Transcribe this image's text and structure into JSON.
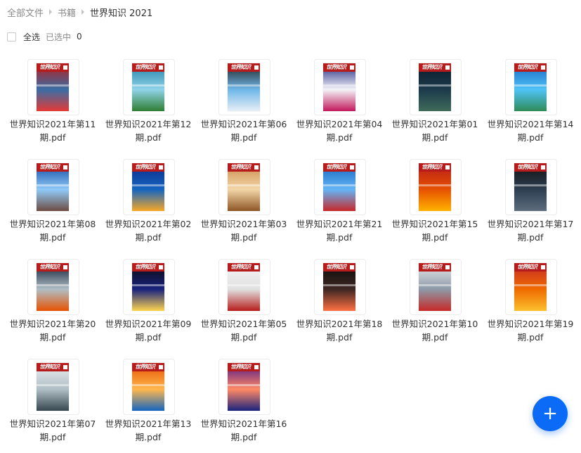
{
  "breadcrumb": [
    {
      "label": "全部文件"
    },
    {
      "label": "书籍"
    },
    {
      "label": "世界知识 2021"
    }
  ],
  "selection": {
    "select_all_label": "全选",
    "selected_label": "已选中",
    "selected_count": "0"
  },
  "masthead_text": "世界知识",
  "files": [
    {
      "name": "世界知识2021年第11期.pdf",
      "cover_colors": [
        "#b71c1c",
        "#3a6ea5",
        "#e53935"
      ]
    },
    {
      "name": "世界知识2021年第12期.pdf",
      "cover_colors": [
        "#1f7fa6",
        "#8fd3e8",
        "#2e7d32"
      ]
    },
    {
      "name": "世界知识2021年第06期.pdf",
      "cover_colors": [
        "#1e1e1e",
        "#6fb7e8",
        "#e8eef5"
      ]
    },
    {
      "name": "世界知识2021年第04期.pdf",
      "cover_colors": [
        "#1a237e",
        "#f3f3f8",
        "#c2185b"
      ]
    },
    {
      "name": "世界知识2021年第01期.pdf",
      "cover_colors": [
        "#0d1b2a",
        "#1b3a4b",
        "#3f6b5a"
      ]
    },
    {
      "name": "世界知识2021年第14期.pdf",
      "cover_colors": [
        "#1565c0",
        "#4fc3f7",
        "#2e8b57"
      ]
    },
    {
      "name": "世界知识2021年第08期.pdf",
      "cover_colors": [
        "#0d47a1",
        "#90caf9",
        "#6d4c41"
      ]
    },
    {
      "name": "世界知识2021年第02期.pdf",
      "cover_colors": [
        "#0d2a8a",
        "#1565c0",
        "#f9a825"
      ]
    },
    {
      "name": "世界知识2021年第03期.pdf",
      "cover_colors": [
        "#c98a4b",
        "#f3d6a7",
        "#8d5524"
      ]
    },
    {
      "name": "世界知识2021年第21期.pdf",
      "cover_colors": [
        "#1565c0",
        "#64b5f6",
        "#c62828"
      ]
    },
    {
      "name": "世界知识2021年第15期.pdf",
      "cover_colors": [
        "#b71c1c",
        "#e65100",
        "#ffb300"
      ]
    },
    {
      "name": "世界知识2021年第17期.pdf",
      "cover_colors": [
        "#111111",
        "#2c3e50",
        "#5d6d7e"
      ]
    },
    {
      "name": "世界知识2021年第20期.pdf",
      "cover_colors": [
        "#0b1a33",
        "#b0bec5",
        "#e65100"
      ]
    },
    {
      "name": "世界知识2021年第09期.pdf",
      "cover_colors": [
        "#0a0a0a",
        "#1a237e",
        "#ffd54f"
      ]
    },
    {
      "name": "世界知识2021年第05期.pdf",
      "cover_colors": [
        "#f5f5f5",
        "#e0e0e0",
        "#b71c1c"
      ]
    },
    {
      "name": "世界知识2021年第18期.pdf",
      "cover_colors": [
        "#0a0a0a",
        "#3e2723",
        "#ff7043"
      ]
    },
    {
      "name": "世界知识2021年第10期.pdf",
      "cover_colors": [
        "#e8eaed",
        "#8d99a6",
        "#c62828"
      ]
    },
    {
      "name": "世界知识2021年第19期.pdf",
      "cover_colors": [
        "#c62828",
        "#ef6c00",
        "#fbc02d"
      ]
    },
    {
      "name": "世界知识2021年第07期.pdf",
      "cover_colors": [
        "#eceff1",
        "#b0bec5",
        "#37474f"
      ]
    },
    {
      "name": "世界知识2021年第13期.pdf",
      "cover_colors": [
        "#e65100",
        "#ffb74d",
        "#1565c0"
      ]
    },
    {
      "name": "世界知识2021年第16期.pdf",
      "cover_colors": [
        "#4a148c",
        "#ff8a65",
        "#1a237e"
      ]
    }
  ],
  "fab_icon": "plus-icon",
  "fab_label": "+",
  "colors": {
    "accent": "#0b6bf7",
    "masthead": "#b71c1c"
  }
}
